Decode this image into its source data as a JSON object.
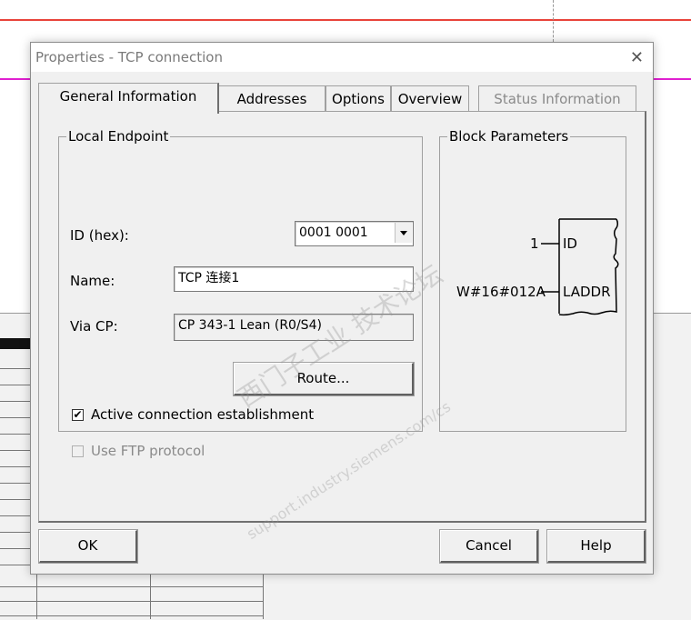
{
  "dialog": {
    "title": "Properties - TCP connection",
    "close_glyph": "✕"
  },
  "tabs": [
    {
      "label": "General Information",
      "active": true,
      "enabled": true
    },
    {
      "label": "Addresses",
      "active": false,
      "enabled": true
    },
    {
      "label": "Options",
      "active": false,
      "enabled": true
    },
    {
      "label": "Overview",
      "active": false,
      "enabled": true
    },
    {
      "label": "Status Information",
      "active": false,
      "enabled": false
    }
  ],
  "local_endpoint": {
    "legend": "Local Endpoint",
    "id_label": "ID (hex):",
    "id_value": "0001 0001",
    "name_label": "Name:",
    "name_value": "TCP 连接1",
    "via_cp_label": "Via CP:",
    "via_cp_value": "CP 343-1 Lean (R0/S4)",
    "route_button": "Route...",
    "active_connection_label": "Active connection establishment",
    "active_connection_checked": true,
    "use_ftp_label": "Use FTP protocol",
    "use_ftp_checked": false,
    "use_ftp_enabled": false
  },
  "block_parameters": {
    "legend": "Block Parameters",
    "params": [
      {
        "value": "1",
        "pin": "ID"
      },
      {
        "value": "W#16#012A",
        "pin": "LADDR"
      }
    ]
  },
  "buttons": {
    "ok": "OK",
    "cancel": "Cancel",
    "help": "Help"
  },
  "watermark": {
    "line1": "西门子工业  技术论坛",
    "line2": "support.industry.siemens.com/cs"
  },
  "colors": {
    "dialog_bg": "#f0f0f0",
    "disabled_text": "#8a8a8a",
    "bg_red_line": "#e8443a",
    "bg_magenta_line": "#e020d0"
  }
}
